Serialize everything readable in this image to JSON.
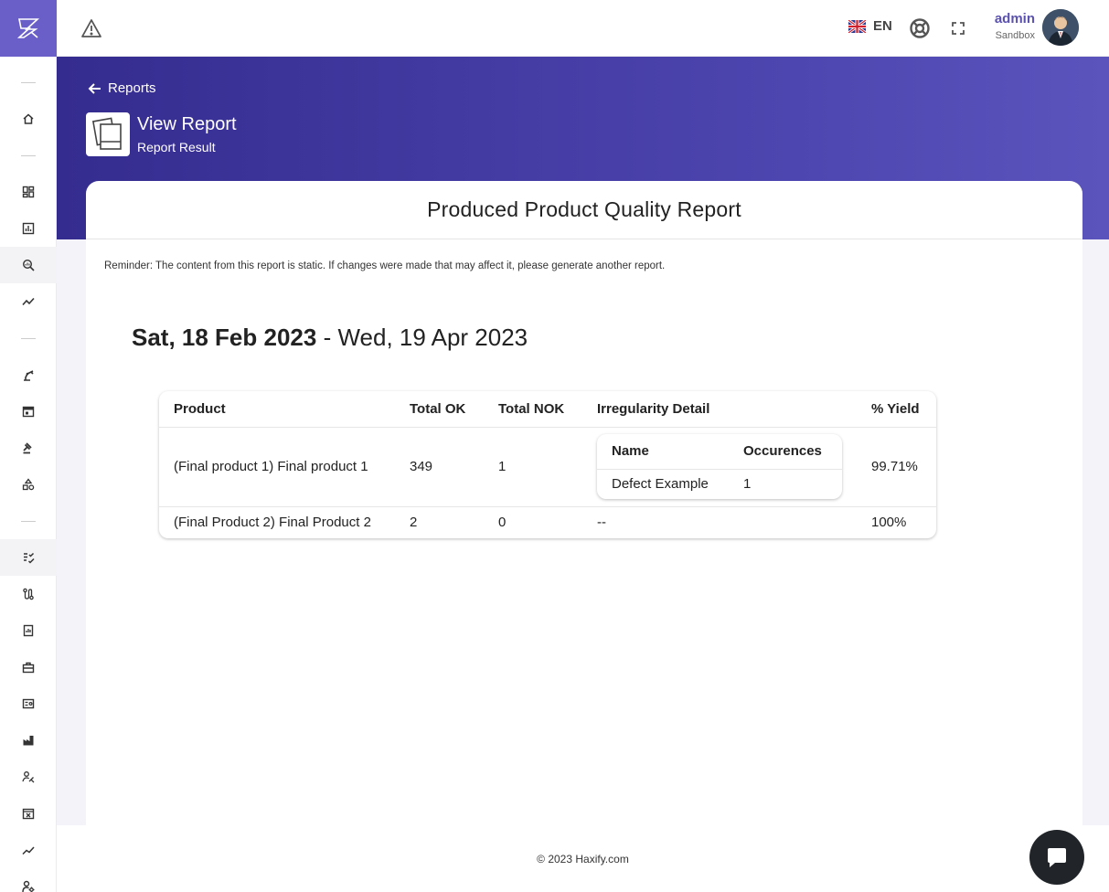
{
  "brand": {
    "logo_icon": "haxify-logo-icon",
    "accent": "#6a5fc8"
  },
  "sidebar": {
    "items": [
      {
        "type": "sep"
      },
      {
        "type": "icon",
        "icon": "home-icon"
      },
      {
        "type": "sep"
      },
      {
        "type": "icon",
        "icon": "dashboard-icon"
      },
      {
        "type": "icon",
        "icon": "bar-chart-icon"
      },
      {
        "type": "icon",
        "icon": "search-analytics-icon",
        "active": true
      },
      {
        "type": "icon",
        "icon": "trend-icon"
      },
      {
        "type": "sep"
      },
      {
        "type": "icon",
        "icon": "robot-arm-icon"
      },
      {
        "type": "icon",
        "icon": "calendar-icon"
      },
      {
        "type": "icon",
        "icon": "gavel-icon"
      },
      {
        "type": "icon",
        "icon": "shapes-icon"
      },
      {
        "type": "sep"
      },
      {
        "type": "icon",
        "icon": "checklist-icon",
        "active": true
      },
      {
        "type": "icon",
        "icon": "route-icon"
      },
      {
        "type": "icon",
        "icon": "report-icon"
      },
      {
        "type": "icon",
        "icon": "toolbox-icon"
      },
      {
        "type": "icon",
        "icon": "id-card-icon"
      },
      {
        "type": "icon",
        "icon": "factory-icon"
      },
      {
        "type": "icon",
        "icon": "signature-icon"
      },
      {
        "type": "icon",
        "icon": "calendar-x-icon"
      },
      {
        "type": "icon",
        "icon": "line-chart-icon"
      },
      {
        "type": "icon",
        "icon": "user-settings-icon"
      }
    ]
  },
  "topbar": {
    "language": "EN",
    "user_name": "admin",
    "user_role": "Sandbox"
  },
  "header": {
    "back_label": "Reports",
    "title": "View Report",
    "subtitle": "Report Result"
  },
  "report": {
    "title": "Produced Product Quality Report",
    "reminder": "Reminder: The content from this report is static. If changes were made that may affect it, please generate another report.",
    "date_start": "Sat, 18 Feb 2023",
    "date_separator": " - ",
    "date_end": "Wed, 19 Apr 2023",
    "columns": [
      "Product",
      "Total OK",
      "Total NOK",
      "Irregularity Detail",
      "% Yield"
    ],
    "rows": [
      {
        "product": "(Final product 1) Final product 1",
        "ok": "349",
        "nok": "1",
        "irregularity": {
          "columns": [
            "Name",
            "Occurences"
          ],
          "rows": [
            {
              "name": "Defect Example",
              "count": "1"
            }
          ]
        },
        "yield": "99.71%"
      },
      {
        "product": "(Final Product 2) Final Product 2",
        "ok": "2",
        "nok": "0",
        "irregularity_text": "--",
        "yield": "100%"
      }
    ]
  },
  "footer": {
    "copyright": "© 2023 Haxify.com"
  }
}
